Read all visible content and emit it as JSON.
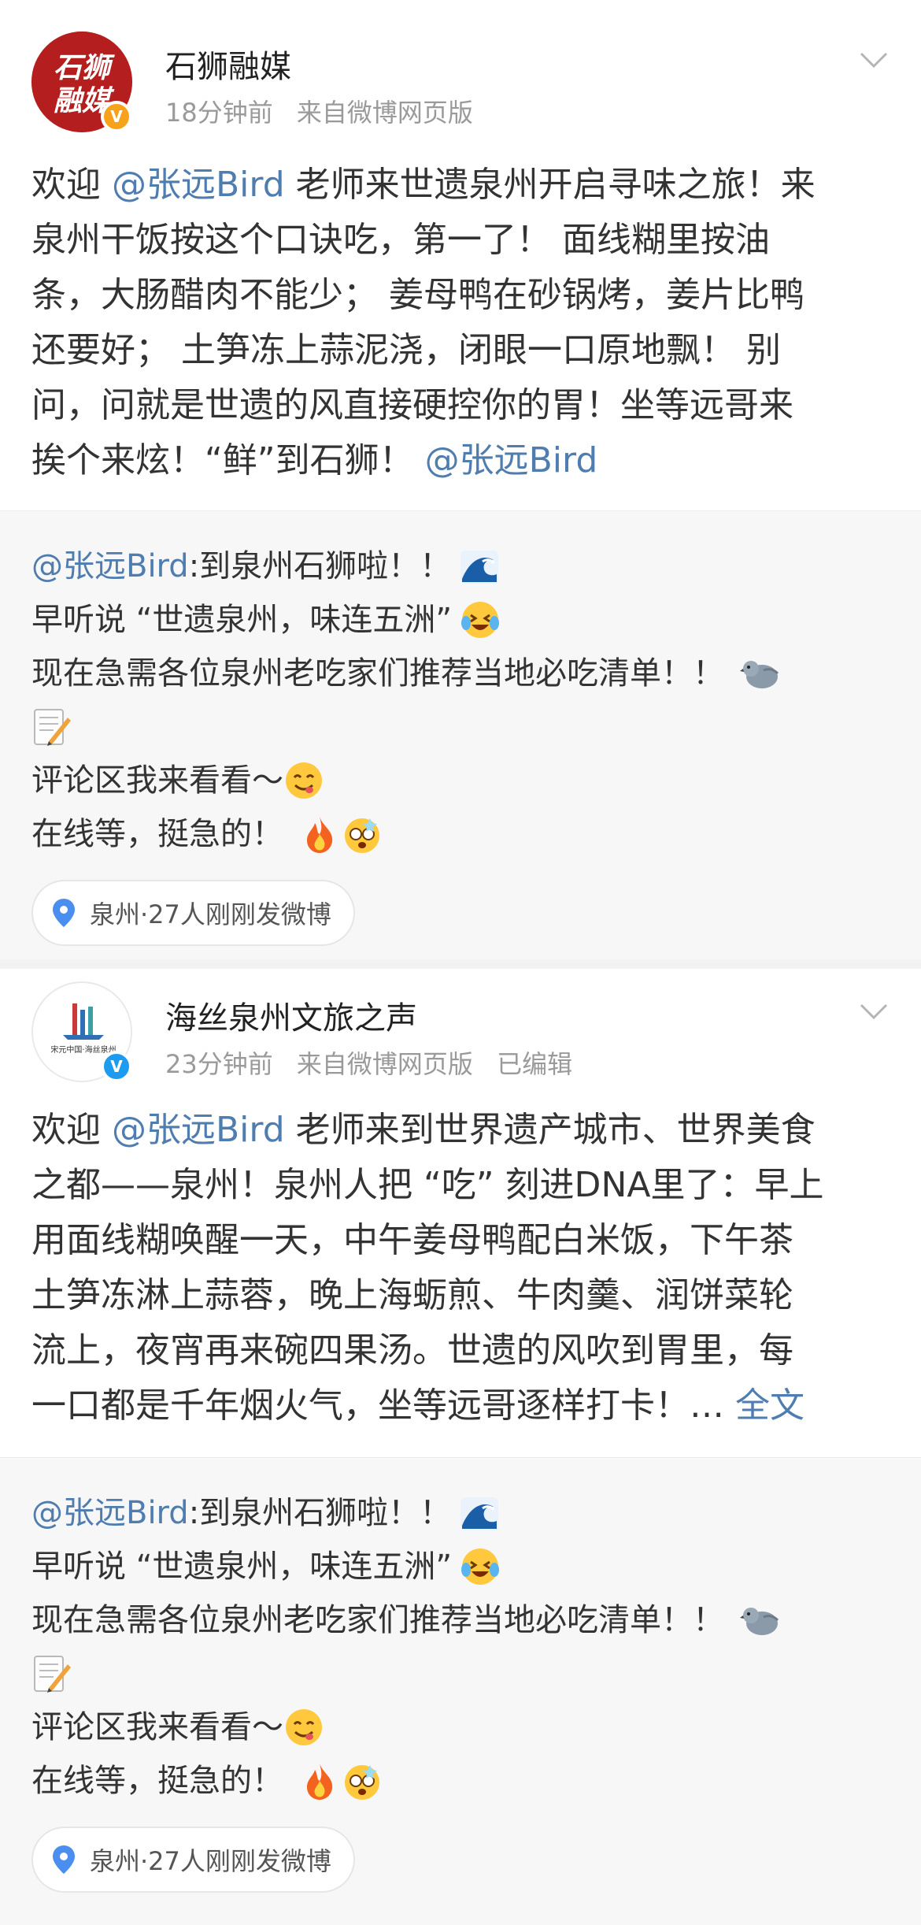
{
  "posts": [
    {
      "author": "石狮融媒",
      "avatar_text": "石狮融媒",
      "verified": "V",
      "time": "18分钟前",
      "source": "来自微博网页版",
      "edited": "",
      "body": {
        "l1_a": "欢迎",
        "l1_mention": "@张远Bird",
        "l1_b": "老师来世遗泉州开启寻味之旅！来",
        "l2": "泉州干饭按这个口诀吃，第一了！ 面线糊里按油",
        "l3": "条，大肠醋肉不能少； 姜母鸭在砂锅烤，姜片比鸭",
        "l4": "还要好； 土笋冻上蒜泥浇，闭眼一口原地飘！ 别",
        "l5": "问，问就是世遗的风直接硬控你的胃！坐等远哥来",
        "l6_a": "挨个来炫！“鲜”到石狮！",
        "l6_mention": "@张远Bird"
      },
      "repost": {
        "mention": "@张远Bird",
        "l1": ":到泉州石狮啦！！",
        "l2": "早听说 “世遗泉州，味连五洲”",
        "l3": "现在急需各位泉州老吃家们推荐当地必吃清单！！",
        "l5": "评论区我来看看～",
        "l6": "在线等，挺急的！",
        "location": "泉州·27人刚刚发微博"
      }
    },
    {
      "author": "海丝泉州文旅之声",
      "avatar_text": "宋元中国·海丝泉州",
      "verified": "V",
      "time": "23分钟前",
      "source": "来自微博网页版",
      "edited": "已编辑",
      "body": {
        "l1_a": "欢迎",
        "l1_mention": "@张远Bird",
        "l1_b": "老师来到世界遗产城市、世界美食",
        "l2": "之都——泉州！泉州人把 “吃” 刻进DNA里了：早上",
        "l3": "用面线糊唤醒一天，中午姜母鸭配白米饭，下午茶",
        "l4": "土笋冻淋上蒜蓉，晚上海蛎煎、牛肉羹、润饼菜轮",
        "l5": "流上，夜宵再来碗四果汤。世遗的风吹到胃里，每",
        "l6_a": "一口都是千年烟火气，坐等远哥逐样打卡！…",
        "more": "全文"
      },
      "repost": {
        "mention": "@张远Bird",
        "l1": ":到泉州石狮啦！！",
        "l2": "早听说 “世遗泉州，味连五洲”",
        "l3": "现在急需各位泉州老吃家们推荐当地必吃清单！！",
        "l5": "评论区我来看看～",
        "l6": "在线等，挺急的！",
        "location": "泉州·27人刚刚发微博"
      }
    }
  ],
  "icons": [
    "chevron-down-icon",
    "wave-emoji",
    "laugh-cry-emoji",
    "pigeon-emoji",
    "memo-emoji",
    "yum-emoji",
    "fire-emoji",
    "dizzy-emoji",
    "location-pin-icon",
    "verified-badge-icon"
  ],
  "colors": {
    "mention": "#507daf",
    "repost_bg": "#f7f7f7",
    "verified_orange": "#f7a21b",
    "verified_blue": "#1d9bf0",
    "avatar_red": "#b41e1e"
  }
}
